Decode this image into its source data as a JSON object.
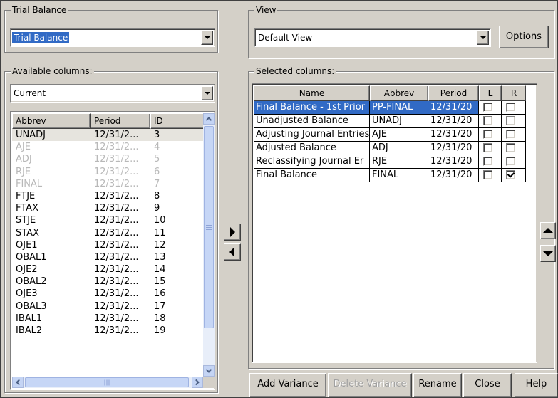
{
  "trial_balance_group": {
    "title": "Trial Balance",
    "selected": "Trial Balance"
  },
  "view_group": {
    "title": "View",
    "selected": "Default View",
    "options_button": "Options"
  },
  "available_group": {
    "title": "Available columns:",
    "filter": "Current",
    "headers": [
      "Abbrev",
      "Period",
      "ID"
    ],
    "rows": [
      {
        "abbrev": "UNADJ",
        "period": "12/31/2...",
        "id": "3",
        "state": "selected"
      },
      {
        "abbrev": "AJE",
        "period": "12/31/2...",
        "id": "4",
        "state": "disabled"
      },
      {
        "abbrev": "ADJ",
        "period": "12/31/2...",
        "id": "5",
        "state": "disabled"
      },
      {
        "abbrev": "RJE",
        "period": "12/31/2...",
        "id": "6",
        "state": "disabled"
      },
      {
        "abbrev": "FINAL",
        "period": "12/31/2...",
        "id": "7",
        "state": "disabled"
      },
      {
        "abbrev": "FTJE",
        "period": "12/31/2...",
        "id": "8",
        "state": "normal"
      },
      {
        "abbrev": "FTAX",
        "period": "12/31/2...",
        "id": "9",
        "state": "normal"
      },
      {
        "abbrev": "STJE",
        "period": "12/31/2...",
        "id": "10",
        "state": "normal"
      },
      {
        "abbrev": "STAX",
        "period": "12/31/2...",
        "id": "11",
        "state": "normal"
      },
      {
        "abbrev": "OJE1",
        "period": "12/31/2...",
        "id": "12",
        "state": "normal"
      },
      {
        "abbrev": "OBAL1",
        "period": "12/31/2...",
        "id": "13",
        "state": "normal"
      },
      {
        "abbrev": "OJE2",
        "period": "12/31/2...",
        "id": "14",
        "state": "normal"
      },
      {
        "abbrev": "OBAL2",
        "period": "12/31/2...",
        "id": "15",
        "state": "normal"
      },
      {
        "abbrev": "OJE3",
        "period": "12/31/2...",
        "id": "16",
        "state": "normal"
      },
      {
        "abbrev": "OBAL3",
        "period": "12/31/2...",
        "id": "17",
        "state": "normal"
      },
      {
        "abbrev": "IBAL1",
        "period": "12/31/2...",
        "id": "18",
        "state": "normal"
      },
      {
        "abbrev": "IBAL2",
        "period": "12/31/2...",
        "id": "19",
        "state": "normal"
      }
    ]
  },
  "selected_group": {
    "title": "Selected columns:",
    "headers": [
      "Name",
      "Abbrev",
      "Period",
      "L",
      "R"
    ],
    "rows": [
      {
        "name": "Final Balance - 1st Prior",
        "abbrev": "PP-FINAL",
        "period": "12/31/20",
        "l": false,
        "r": false,
        "highlight": true
      },
      {
        "name": "Unadjusted Balance",
        "abbrev": "UNADJ",
        "period": "12/31/20",
        "l": false,
        "r": false,
        "highlight": false
      },
      {
        "name": "Adjusting Journal Entries",
        "abbrev": "AJE",
        "period": "12/31/20",
        "l": false,
        "r": false,
        "highlight": false
      },
      {
        "name": "Adjusted Balance",
        "abbrev": "ADJ",
        "period": "12/31/20",
        "l": false,
        "r": false,
        "highlight": false
      },
      {
        "name": "Reclassifying Journal Er",
        "abbrev": "RJE",
        "period": "12/31/20",
        "l": false,
        "r": false,
        "highlight": false
      },
      {
        "name": "Final Balance",
        "abbrev": "FINAL",
        "period": "12/31/20",
        "l": false,
        "r": true,
        "highlight": false
      }
    ]
  },
  "icons": {
    "add_column": "triangle-right-icon",
    "remove_column": "triangle-left-icon",
    "move_up": "triangle-up-icon",
    "move_down": "triangle-down-icon"
  },
  "footer_buttons": {
    "add_variance": "Add Variance",
    "delete_variance": "Delete Variance",
    "rename": "Rename",
    "close": "Close",
    "help": "Help"
  },
  "colors": {
    "dialog_bg": "#d4d0c8",
    "selection": "#316ac5",
    "scrollbar_track": "#e8eef9",
    "disabled_text": "#b8b8b8"
  }
}
